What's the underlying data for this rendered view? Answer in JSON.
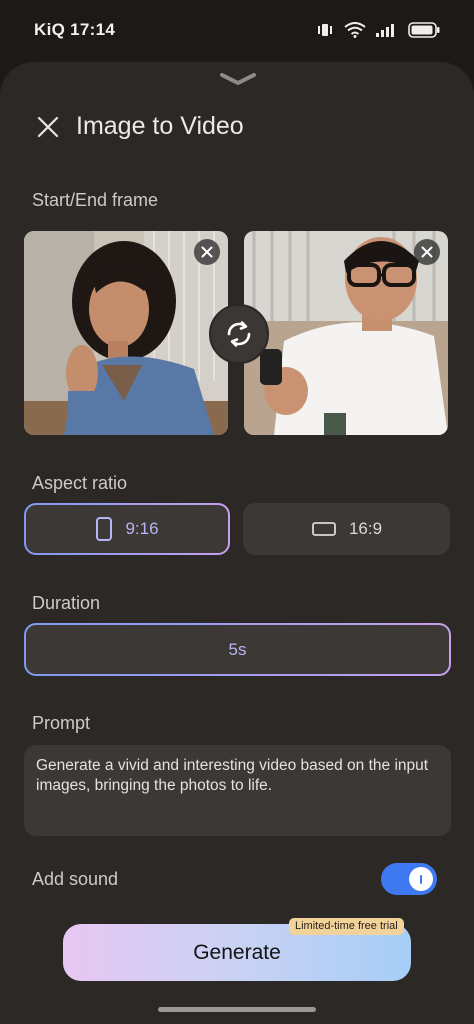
{
  "status_bar": {
    "carrier_time": "KiQ 17:14"
  },
  "sheet": {
    "title": "Image to Video",
    "sections": {
      "frames_label": "Start/End frame",
      "aspect_label": "Aspect ratio",
      "duration_label": "Duration",
      "prompt_label": "Prompt",
      "sound_label": "Add sound"
    },
    "aspect_options": [
      {
        "label": "9:16",
        "selected": true
      },
      {
        "label": "16:9",
        "selected": false
      }
    ],
    "duration_value": "5s",
    "prompt_text": "Generate a vivid and interesting video based on the input images, bringing the photos to life.",
    "add_sound_enabled": true,
    "generate_label": "Generate",
    "trial_badge": "Limited-time free trial"
  },
  "icons": [
    "chevron-down-icon",
    "close-icon",
    "swap-icon",
    "portrait-ratio-icon",
    "landscape-ratio-icon"
  ],
  "colors": {
    "accent_blue": "#3f79f2",
    "selected_text": "#b9b4f4",
    "badge": "#f1d29a"
  }
}
